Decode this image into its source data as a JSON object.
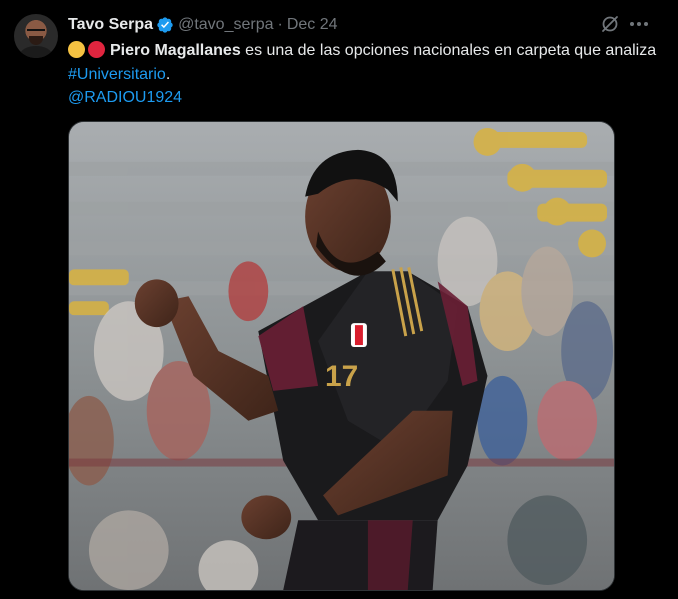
{
  "tweet": {
    "author_name": "Tavo Serpa",
    "handle": "@tavo_serpa",
    "separator": "·",
    "date": "Dec 24",
    "emoji_1": "yellow-circle",
    "emoji_2": "red-circle",
    "text_bold": "Piero Magallanes",
    "text_part1": " es una de las opciones nacionales en carpeta que analiza ",
    "hashtag": "#Universitario",
    "text_end": ".",
    "mention": "@RADIOU1924",
    "media_alt": "Football player in dark Peru jersey celebrating with clenched fist"
  },
  "colors": {
    "background": "#000000",
    "text": "#e7e9ea",
    "muted": "#71767b",
    "link": "#1d9bf0",
    "verified": "#1d9bf0"
  }
}
